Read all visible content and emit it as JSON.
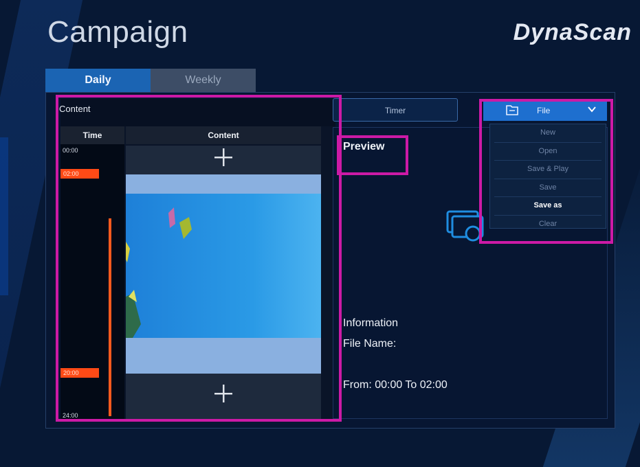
{
  "header": {
    "title": "Campaign",
    "logo_text": "DynaScan"
  },
  "tabs": [
    {
      "label": "Daily",
      "selected": true
    },
    {
      "label": "Weekly",
      "selected": false
    }
  ],
  "content_panel": {
    "title": "Content",
    "columns": {
      "time": "Time",
      "content": "Content"
    },
    "time_labels": {
      "start": "00:00",
      "end": "24:00"
    },
    "time_badges": {
      "from": "02:00",
      "to": "20:00"
    }
  },
  "timer_button": {
    "label": "Timer"
  },
  "preview": {
    "label": "Preview",
    "information_heading": "Information",
    "file_name_label": "File Name:",
    "range_text": "From: 00:00 To 02:00"
  },
  "file_menu": {
    "button_label": "File",
    "items": [
      "New",
      "Open",
      "Save & Play",
      "Save",
      "Save as",
      "Clear"
    ],
    "active_item": "Save as"
  },
  "colors": {
    "accent_blue": "#1e6fcf",
    "timeline_orange": "#ff4a16",
    "highlight_magenta": "#cc1aa6",
    "background": "#071834"
  },
  "icons": [
    "plus-icon",
    "file-icon",
    "chevron-down-icon",
    "preview-photos-icon"
  ]
}
